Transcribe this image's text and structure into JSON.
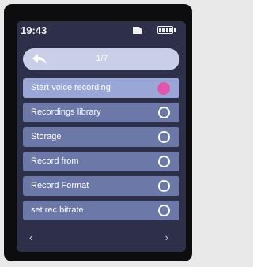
{
  "status": {
    "time": "19:43"
  },
  "header": {
    "page": "1/7"
  },
  "menu": {
    "items": [
      {
        "label": "Start voice recording",
        "selected": true
      },
      {
        "label": "Recordings library",
        "selected": false
      },
      {
        "label": "Storage",
        "selected": false
      },
      {
        "label": "Record from",
        "selected": false
      },
      {
        "label": "Record Format",
        "selected": false
      },
      {
        "label": "set rec bitrate",
        "selected": false
      }
    ]
  },
  "nav": {
    "prev": "‹",
    "next": "›"
  },
  "colors": {
    "screen_bg": "#2d3048",
    "item_bg": "#6c78a8",
    "item_selected_bg": "#9aa6d6",
    "accent": "#e055b0"
  }
}
